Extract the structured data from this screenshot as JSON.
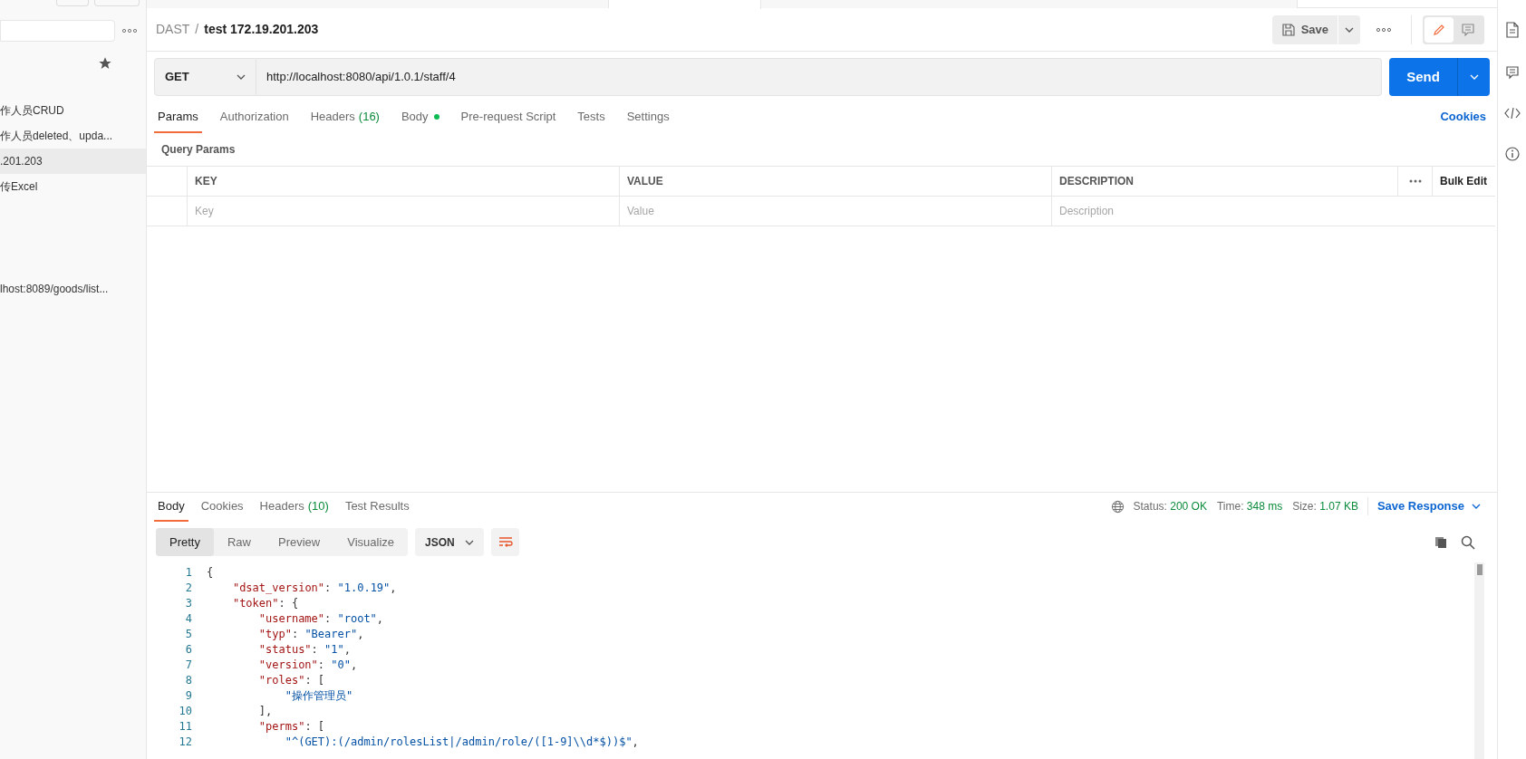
{
  "sidebar": {
    "items": [
      {
        "label": "作人员CRUD",
        "selected": false
      },
      {
        "label": "作人员deleted、upda...",
        "selected": false
      },
      {
        "label": ".201.203",
        "selected": true
      },
      {
        "label": "传Excel",
        "selected": false
      },
      {
        "label": "lhost:8089/goods/list...",
        "selected": false
      }
    ]
  },
  "open_tabs": [
    {
      "selected": false
    },
    {
      "selected": true
    },
    {
      "selected": false
    }
  ],
  "view_toggle": [
    {
      "kind": "edit",
      "selected": true
    },
    {
      "kind": "comments",
      "selected": false
    }
  ],
  "breadcrumb": {
    "parent": "DAST",
    "separator": "/",
    "title": "test 172.19.201.203"
  },
  "toolbar": {
    "save": "Save"
  },
  "request": {
    "method": "GET",
    "url": "http://localhost:8080/api/1.0.1/staff/4",
    "send": "Send"
  },
  "request_tabs": [
    {
      "label": "Params",
      "selected": true
    },
    {
      "label": "Authorization",
      "selected": false
    },
    {
      "label": "Headers",
      "count": "(16)",
      "selected": false
    },
    {
      "label": "Body",
      "indicator": true,
      "selected": false
    },
    {
      "label": "Pre-request Script",
      "selected": false
    },
    {
      "label": "Tests",
      "selected": false
    },
    {
      "label": "Settings",
      "selected": false
    }
  ],
  "cookies_link": "Cookies",
  "query_params": {
    "title": "Query Params",
    "columns": [
      "KEY",
      "VALUE",
      "DESCRIPTION"
    ],
    "bulk_edit": "Bulk Edit",
    "placeholders": [
      "Key",
      "Value",
      "Description"
    ]
  },
  "response_tabs": [
    {
      "label": "Body",
      "selected": true
    },
    {
      "label": "Cookies",
      "selected": false
    },
    {
      "label": "Headers",
      "count": "(10)",
      "selected": false
    },
    {
      "label": "Test Results",
      "selected": false
    }
  ],
  "response_status": [
    {
      "label": "Status:",
      "value": "200 OK"
    },
    {
      "label": "Time:",
      "value": "348 ms"
    },
    {
      "label": "Size:",
      "value": "1.07 KB"
    }
  ],
  "save_response": "Save Response",
  "view_modes": [
    {
      "label": "Pretty",
      "selected": true
    },
    {
      "label": "Raw",
      "selected": false
    },
    {
      "label": "Preview",
      "selected": false
    },
    {
      "label": "Visualize",
      "selected": false
    }
  ],
  "format": "JSON",
  "code_lines": [
    {
      "number": "1",
      "text": "{"
    },
    {
      "number": "2",
      "text": "    \"dsat_version\": \"1.0.19\","
    },
    {
      "number": "3",
      "text": "    \"token\": {"
    },
    {
      "number": "4",
      "text": "        \"username\": \"root\","
    },
    {
      "number": "5",
      "text": "        \"typ\": \"Bearer\","
    },
    {
      "number": "6",
      "text": "        \"status\": \"1\","
    },
    {
      "number": "7",
      "text": "        \"version\": \"0\","
    },
    {
      "number": "8",
      "text": "        \"roles\": ["
    },
    {
      "number": "9",
      "text": "            \"操作管理员\""
    },
    {
      "number": "10",
      "text": "        ],"
    },
    {
      "number": "11",
      "text": "        \"perms\": ["
    },
    {
      "number": "12",
      "text": "            \"^(GET):(/admin/rolesList|/admin/role/([1-9]\\\\d*$))$\","
    }
  ]
}
